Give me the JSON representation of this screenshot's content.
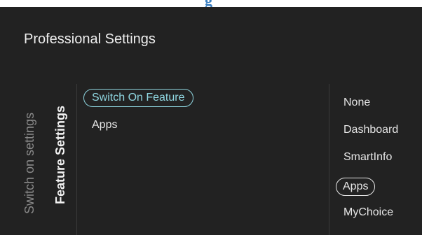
{
  "top_strip_text": "g",
  "header": {
    "title": "Professional Settings"
  },
  "side_tabs": [
    {
      "label": "Switch on settings",
      "active": false
    },
    {
      "label": "Feature Settings",
      "active": true
    }
  ],
  "menu": {
    "items": [
      {
        "label": "Switch On Feature",
        "selected": true
      },
      {
        "label": "Apps",
        "selected": false
      }
    ]
  },
  "options": {
    "items": [
      {
        "label": "None",
        "selected": false
      },
      {
        "label": "Dashboard",
        "selected": false
      },
      {
        "label": "SmartInfo",
        "selected": false
      },
      {
        "label": "Apps",
        "selected": true
      },
      {
        "label": "MyChoice",
        "selected": false
      }
    ]
  },
  "colors": {
    "background": "#222222",
    "accent": "#8fd6e0",
    "text": "#e6e6e6",
    "inactive_tab": "#8a8a8a",
    "heading_strip": "#3a7fc1"
  }
}
